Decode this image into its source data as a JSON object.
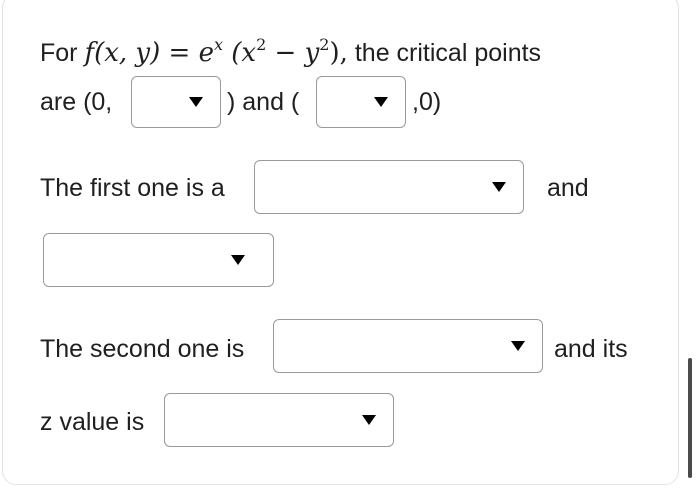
{
  "question": {
    "line1_prefix": "For",
    "func_lhs": "f(x, y)",
    "func_eq": "=",
    "func_base": "e",
    "func_exp": "x",
    "func_paren_open": "(x",
    "func_sq1": "2",
    "func_minus": " − y",
    "func_sq2": "2",
    "func_paren_close": "),",
    "line1_suffix": "the critical points",
    "line2_prefix": "are (0,",
    "line2_mid": ") and (",
    "line2_suffix": ",0)",
    "line3_text": "The first one is a",
    "line3_after": "and",
    "line5_text": "The second one is",
    "line5_after": "and its",
    "line6_text": "z value is"
  },
  "dropdowns": {
    "cp1_y": {
      "selected": ""
    },
    "cp2_x": {
      "selected": ""
    },
    "first_type": {
      "selected": ""
    },
    "first_type_cont": {
      "selected": ""
    },
    "second_type": {
      "selected": ""
    },
    "z_value": {
      "selected": ""
    }
  },
  "icons": {
    "caret": "triangle-down"
  },
  "colors": {
    "border": "#9a9a9a",
    "text": "#1f1f1f",
    "caret": "#000000"
  }
}
